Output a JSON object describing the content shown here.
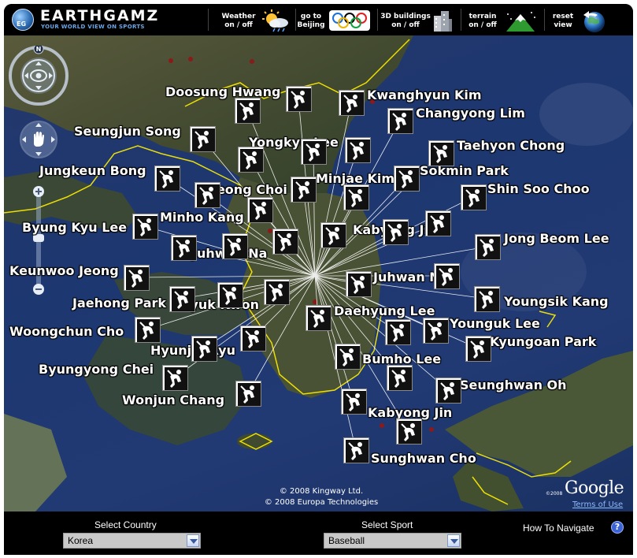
{
  "header": {
    "logo_badge": "EG",
    "brand": "EARTHGAMZ",
    "tagline": "YOUR WORLD VIEW ON SPORTS",
    "toolbar": [
      {
        "id": "weather",
        "line1": "Weather",
        "line2": "on / off",
        "icon": "weather-icon"
      },
      {
        "id": "beijing",
        "line1": "go to",
        "line2": "Beijing",
        "icon": "olympic-rings-icon"
      },
      {
        "id": "buildings",
        "line1": "3D buildings",
        "line2": "on / off",
        "icon": "buildings-icon"
      },
      {
        "id": "terrain",
        "line1": "terrain",
        "line2": "on / off",
        "icon": "terrain-icon"
      },
      {
        "id": "reset",
        "line1": "reset",
        "line2": "view",
        "icon": "globe-reset-icon"
      }
    ]
  },
  "map": {
    "compass_label": "N",
    "players": [
      "Doosung Hwang",
      "Kwanghyun Kim",
      "Changyong Lim",
      "Seungjun Song",
      "Yongkyu Lee",
      "Taehyon Chong",
      "Jungkeun Bong",
      "Sokmin Park",
      "Minjae Kim",
      "Jeong Choi",
      "Shin Soo Choo",
      "Minho Kang",
      "Byung Kyu Lee",
      "Kabyong Jin",
      "Jong Beom Lee",
      "Juhwan Na",
      "Keunwoo Jeong",
      "Juhwan Na",
      "Jaehong Park",
      "Hyuk Kwon",
      "Youngsik Kang",
      "Daehyung Lee",
      "Woongchun Cho",
      "Younguk Lee",
      "Kyungoan Park",
      "Hyunjin Ryu",
      "Bumho Lee",
      "Byungyong Chei",
      "Seunghwan Oh",
      "Wonjun Chang",
      "Kabyong Jin",
      "Sunghwan Cho"
    ],
    "copyright_lines": [
      "© 2008 Kingway Ltd.",
      "© 2008 Europa Technologies"
    ],
    "google_logo": "Google",
    "google_year": "©2008",
    "terms_link": "Terms of Use"
  },
  "footer": {
    "country_label": "Select Country",
    "country_value": "Korea",
    "sport_label": "Select Sport",
    "sport_value": "Baseball",
    "howto_label": "How To Navigate",
    "help_glyph": "?"
  },
  "colors": {
    "ocean": "#1d3770",
    "land": "#3b4a2c",
    "border_line": "#ffee00",
    "marker_bg": "#ffffff"
  }
}
